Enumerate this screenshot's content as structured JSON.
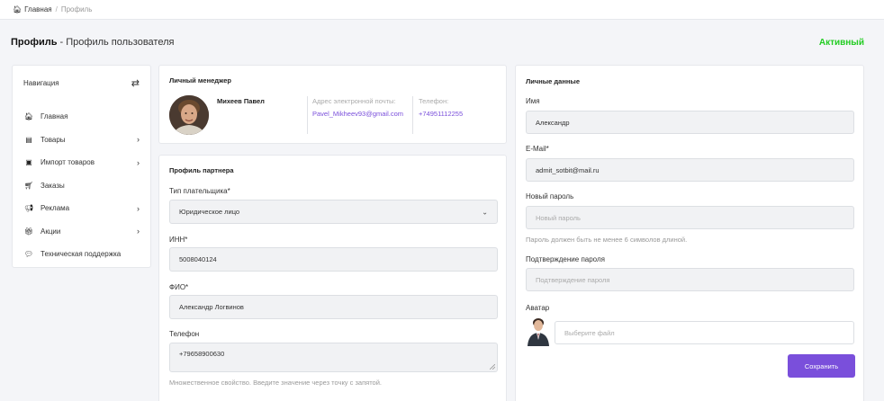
{
  "breadcrumb": {
    "home": "Главная",
    "separator": "/",
    "current": "Профиль"
  },
  "header": {
    "title_bold": "Профиль",
    "title_rest": " - Профиль пользователя",
    "status": "Активный"
  },
  "colors": {
    "accent": "#7a4fdb",
    "status": "#22cc22"
  },
  "nav": {
    "title": "Навигация",
    "items": [
      {
        "icon": "home-icon",
        "label": "Главная",
        "arrow": ""
      },
      {
        "icon": "box-icon",
        "label": "Товары",
        "arrow": "›"
      },
      {
        "icon": "import-icon",
        "label": "Импорт товаров",
        "arrow": "›"
      },
      {
        "icon": "cart-icon",
        "label": "Заказы",
        "arrow": ""
      },
      {
        "icon": "megaphone-icon",
        "label": "Реклама",
        "arrow": "›"
      },
      {
        "icon": "gift-icon",
        "label": "Акции",
        "arrow": "›"
      },
      {
        "icon": "support-icon",
        "label": "Техническая поддержка",
        "arrow": ""
      }
    ]
  },
  "manager": {
    "title": "Личный менеджер",
    "name": "Михеев Павел",
    "email_label": "Адрес электронной почты:",
    "email": "Pavel_Mikheev93@gmail.com",
    "phone_label": "Телефон:",
    "phone": "+74951112255"
  },
  "partner": {
    "title": "Профиль партнера",
    "payer_type_label": "Тип плательщика*",
    "payer_type_value": "Юридическое лицо",
    "inn_label": "ИНН*",
    "inn_value": "5008040124",
    "fio_label": "ФИО*",
    "fio_value": "Александр Логвинов",
    "phone_label": "Телефон",
    "phone_value": "+79658900630",
    "phone_hint": "Множественное свойство. Введите значение через точку с запятой."
  },
  "personal": {
    "title": "Личные данные",
    "name_label": "Имя",
    "name_value": "Александр",
    "email_label": "E-Mail*",
    "email_value": "admit_sotbit@mail.ru",
    "new_password_label": "Новый пароль",
    "new_password_placeholder": "Новый пароль",
    "password_hint": "Пароль должен быть не менее 6 символов длиной.",
    "confirm_label": "Подтверждение пароля",
    "confirm_placeholder": "Подтверждение пароля",
    "avatar_label": "Аватар",
    "file_placeholder": "Выберите файл",
    "save_label": "Сохранить"
  }
}
